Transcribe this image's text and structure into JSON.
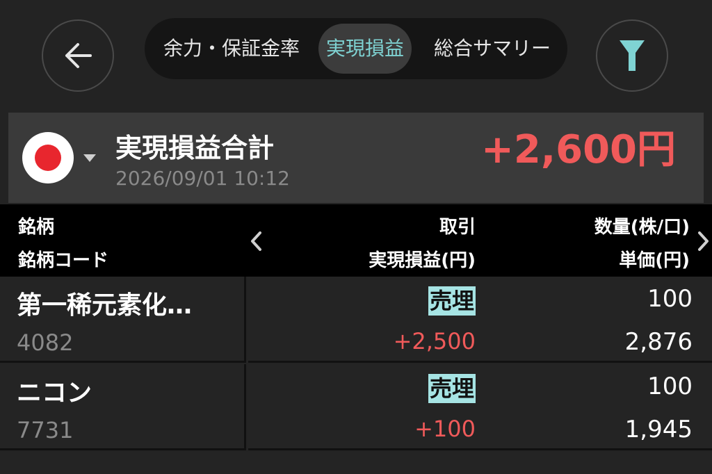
{
  "header": {
    "tabs": [
      {
        "label": "余力・保証金率"
      },
      {
        "label": "実現損益"
      },
      {
        "label": "総合サマリー"
      }
    ],
    "active_tab": "実現損益",
    "icons": {
      "back": "back-arrow-icon",
      "filter": "filter-funnel-icon"
    }
  },
  "summary": {
    "title": "実現損益合計",
    "datetime": "2026/09/01 10:12",
    "total": "+2,600円",
    "market_icon": "japan-flag-icon"
  },
  "table": {
    "headers": {
      "name": "銘柄",
      "code": "銘柄コード",
      "trade": "取引",
      "pnl": "実現損益(円)",
      "qty": "数量(株/口)",
      "price": "単価(円)"
    },
    "rows": [
      {
        "name": "第一稀元素化…",
        "code": "4082",
        "trade": "売埋",
        "pnl": "+2,500",
        "qty": "100",
        "price": "2,876"
      },
      {
        "name": "ニコン",
        "code": "7731",
        "trade": "売埋",
        "pnl": "+100",
        "qty": "100",
        "price": "1,945"
      }
    ]
  },
  "colors": {
    "background": "#232323",
    "accent_teal": "#7fd3d3",
    "badge_teal": "#a6e4e4",
    "profit_red": "#f05a5a",
    "flag_red": "#e8262e"
  }
}
